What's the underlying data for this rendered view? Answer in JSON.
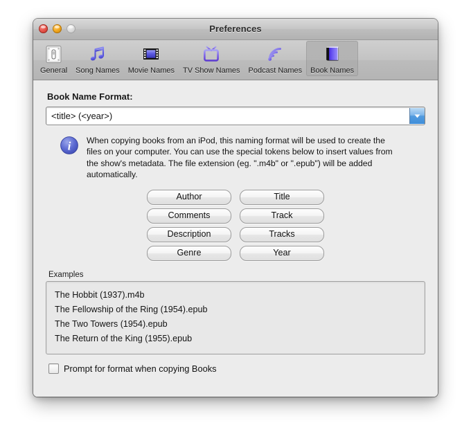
{
  "window": {
    "title": "Preferences",
    "controls": [
      {
        "name": "close",
        "label": "Close"
      },
      {
        "name": "minimize",
        "label": "Minimize"
      },
      {
        "name": "zoom",
        "label": "Zoom"
      }
    ]
  },
  "toolbar": {
    "items": [
      {
        "label": "General",
        "icon": "light-switch-icon",
        "selected": false
      },
      {
        "label": "Song Names",
        "icon": "music-note-icon",
        "selected": false
      },
      {
        "label": "Movie Names",
        "icon": "film-strip-icon",
        "selected": false
      },
      {
        "label": "TV Show Names",
        "icon": "television-icon",
        "selected": false
      },
      {
        "label": "Podcast Names",
        "icon": "rss-waves-icon",
        "selected": false
      },
      {
        "label": "Book Names",
        "icon": "book-icon",
        "selected": true
      }
    ]
  },
  "main": {
    "format_field": {
      "label": "Book Name Format:",
      "value": "<title> (<year>)",
      "placeholder": "<title> (<year>)",
      "dropdown_icon": "chevron-down-icon"
    },
    "info": {
      "icon": "info-circle-icon",
      "text": "When copying books from an iPod, this naming format will be used to create the files on your computer. You can use the special tokens below to insert values from the show's metadata. The file extension (eg. \".m4b\" or \".epub\") will be added automatically."
    },
    "tokens": [
      {
        "label": "Author"
      },
      {
        "label": "Title"
      },
      {
        "label": "Comments"
      },
      {
        "label": "Track"
      },
      {
        "label": "Description"
      },
      {
        "label": "Tracks"
      },
      {
        "label": "Genre"
      },
      {
        "label": "Year"
      }
    ],
    "examples": {
      "label": "Examples",
      "lines": [
        "The Hobbit (1937).m4b",
        "The Fellowship of the Ring (1954).epub",
        "The Two Towers (1954).epub",
        "The Return of the King (1955).epub"
      ]
    },
    "prompt_checkbox": {
      "label": "Prompt for format when copying Books",
      "checked": false
    }
  },
  "colors": {
    "window_chrome": "#c3c3c3",
    "content_bg": "#ececec",
    "accent_blue": "#3f8ed9",
    "icon_purple": "#5a4fe0",
    "info_blue": "#5b6fd0",
    "close_red": "#e8564d",
    "minimize_amber": "#f4a91f"
  }
}
